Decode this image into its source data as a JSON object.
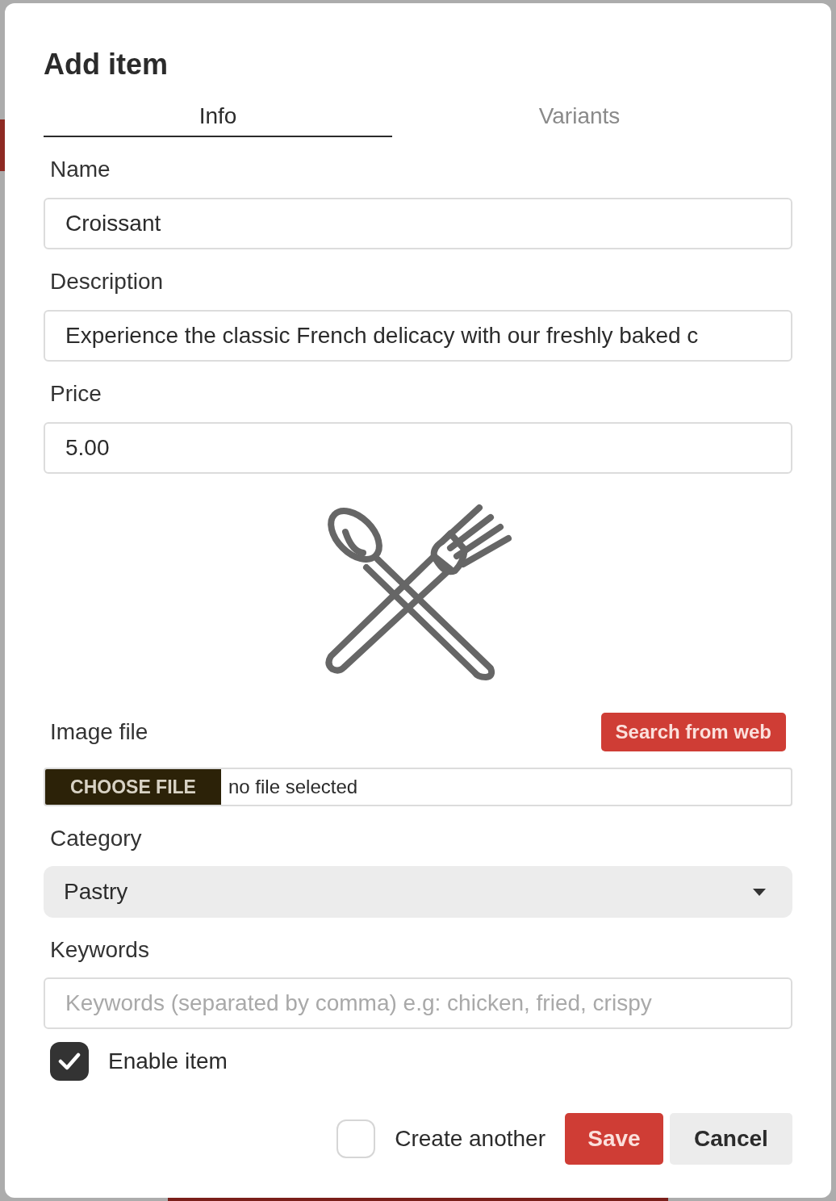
{
  "dialog": {
    "title": "Add item"
  },
  "tabs": [
    {
      "label": "Info",
      "selected": true
    },
    {
      "label": "Variants",
      "selected": false
    }
  ],
  "fields": [
    {
      "kind": "text",
      "label": "Name",
      "value": "Croissant"
    },
    {
      "kind": "text",
      "label": "Description",
      "value": "Experience the classic French delicacy with our freshly baked c"
    },
    {
      "kind": "text",
      "label": "Price",
      "value": "5.00"
    }
  ],
  "image_file": {
    "label": "Image file",
    "search_button": "Search from web",
    "choose_button": "CHOOSE FILE",
    "status": "no file selected"
  },
  "category": {
    "label": "Category",
    "value": "Pastry"
  },
  "keywords": {
    "label": "Keywords",
    "placeholder": "Keywords (separated by comma) e.g: chicken, fried, crispy"
  },
  "enable_item": {
    "label": "Enable item",
    "checked": true
  },
  "footer": {
    "create_another": {
      "label": "Create another",
      "checked": false
    },
    "buttons": [
      {
        "kind": "primary",
        "label": "Save"
      },
      {
        "kind": "secondary",
        "label": "Cancel"
      }
    ]
  }
}
